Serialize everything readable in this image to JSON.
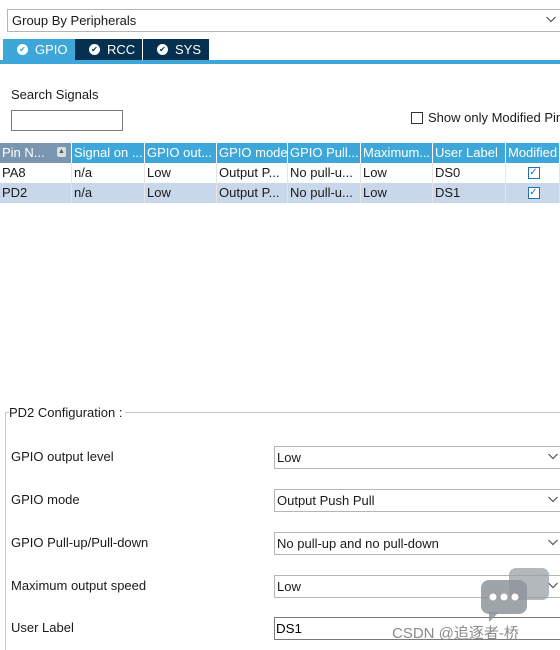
{
  "group_select": {
    "value": "Group By Peripherals"
  },
  "tabs": [
    {
      "label": "GPIO",
      "active": true
    },
    {
      "label": "RCC",
      "active": false
    },
    {
      "label": "SYS",
      "active": false
    }
  ],
  "search": {
    "label": "Search Signals",
    "value": ""
  },
  "show_only_modified": {
    "label": "Show only Modified Pin",
    "checked": false
  },
  "table": {
    "columns": [
      "Pin N...",
      "Signal on ...",
      "GPIO out...",
      "GPIO mode",
      "GPIO Pull...",
      "Maximum...",
      "User Label",
      "Modified"
    ],
    "rows": [
      {
        "pin": "PA8",
        "signal": "n/a",
        "output": "Low",
        "mode": "Output P...",
        "pull": "No pull-u...",
        "speed": "Low",
        "label": "DS0",
        "modified": true,
        "selected": false
      },
      {
        "pin": "PD2",
        "signal": "n/a",
        "output": "Low",
        "mode": "Output P...",
        "pull": "No pull-u...",
        "speed": "Low",
        "label": "DS1",
        "modified": true,
        "selected": true
      }
    ]
  },
  "config": {
    "title": "PD2 Configuration :",
    "fields": [
      {
        "label": "GPIO output level",
        "value": "Low"
      },
      {
        "label": "GPIO mode",
        "value": "Output Push Pull"
      },
      {
        "label": "GPIO Pull-up/Pull-down",
        "value": "No pull-up and no pull-down"
      },
      {
        "label": "Maximum output speed",
        "value": "Low"
      },
      {
        "label": "User Label",
        "value": "DS1"
      }
    ]
  },
  "watermark": "CSDN @追逐者-桥",
  "colors": {
    "tab_active": "#3ea7d9",
    "tab_inactive": "#05304f",
    "selected_row": "#c8d8ea",
    "header_bg": "#3ea7d9"
  }
}
